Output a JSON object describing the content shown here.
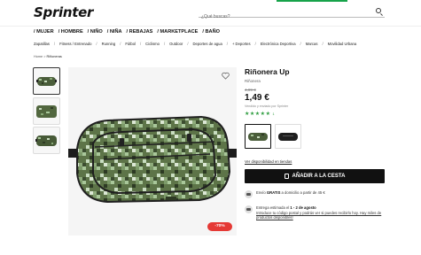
{
  "header": {
    "logo": "Sprinter",
    "search_placeholder": "¿Qué buscas?"
  },
  "main_nav": [
    "/ MUJER",
    "/ HOMBRE",
    "/ NIÑO",
    "/ NIÑA",
    "/ REBAJAS",
    "/ MARKETPLACE",
    "/ BAÑO"
  ],
  "sub_nav": [
    "Zapatillas",
    "Fitness / Entrenado",
    "Running",
    "Fútbol",
    "Ciclismo",
    "Outdoor",
    "Deportes de agua",
    "+ Deportes",
    "Electrónica Deportiva",
    "Marcas",
    "Movilidad Urbana"
  ],
  "breadcrumb": {
    "home": "Home",
    "sep": ">",
    "current": "Riñoneras"
  },
  "product": {
    "title": "Riñonera Up",
    "brand": "Riñonera",
    "old_price": "4,99 €",
    "price": "1,49 €",
    "sold_by": "Vendido y enviado por Sprinter",
    "rating": 5,
    "rating_count": "1",
    "discount_badge": "-70%"
  },
  "actions": {
    "availability_link": "Ver disponibilidad en tiendas",
    "add_to_cart": "AÑADIR A LA CESTA"
  },
  "shipping": {
    "line1_prefix": "Envío ",
    "line1_bold": "GRATIS",
    "line1_suffix": " a domicilio a partir de 45 €",
    "line2_prefix": "Entrega estimada el ",
    "line2_bold": "1 - 2 de agosto",
    "line2_link": "Introduce tu código postal y podrás ver si puedes recibirlo hoy. Hay miles de productos disponibles!"
  },
  "colors": {
    "accent": "#17a34a",
    "star": "#2e9d3f",
    "badge": "#e53935",
    "button": "#111111"
  }
}
